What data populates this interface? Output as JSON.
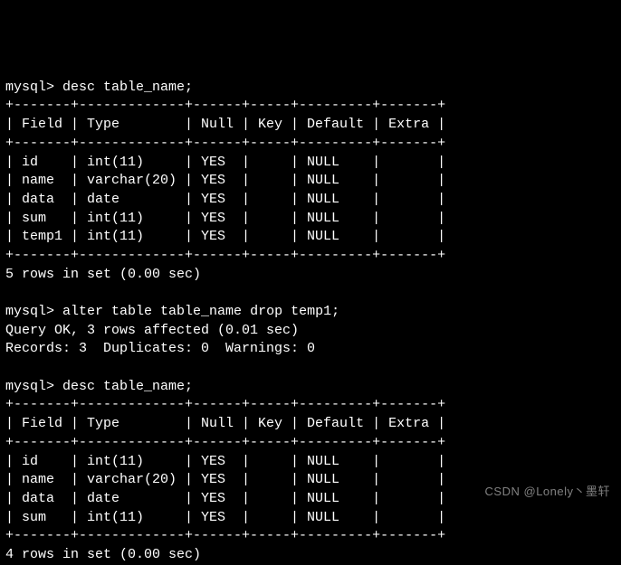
{
  "prompt": "mysql>",
  "cmd1": "desc table_name;",
  "table1": {
    "sep": "+-------+-------------+------+-----+---------+-------+",
    "head": "| Field | Type        | Null | Key | Default | Extra |",
    "rows": [
      "| id    | int(11)     | YES  |     | NULL    |       |",
      "| name  | varchar(20) | YES  |     | NULL    |       |",
      "| data  | date        | YES  |     | NULL    |       |",
      "| sum   | int(11)     | YES  |     | NULL    |       |",
      "| temp1 | int(11)     | YES  |     | NULL    |       |"
    ],
    "footer": "5 rows in set (0.00 sec)"
  },
  "cmd2": "alter table table_name drop temp1;",
  "result2a": "Query OK, 3 rows affected (0.01 sec)",
  "result2b": "Records: 3  Duplicates: 0  Warnings: 0",
  "cmd3": "desc table_name;",
  "table2": {
    "sep": "+-------+-------------+------+-----+---------+-------+",
    "head": "| Field | Type        | Null | Key | Default | Extra |",
    "rows": [
      "| id    | int(11)     | YES  |     | NULL    |       |",
      "| name  | varchar(20) | YES  |     | NULL    |       |",
      "| data  | date        | YES  |     | NULL    |       |",
      "| sum   | int(11)     | YES  |     | NULL    |       |"
    ],
    "footer": "4 rows in set (0.00 sec)"
  },
  "watermark": "CSDN @Lonely丶墨轩"
}
